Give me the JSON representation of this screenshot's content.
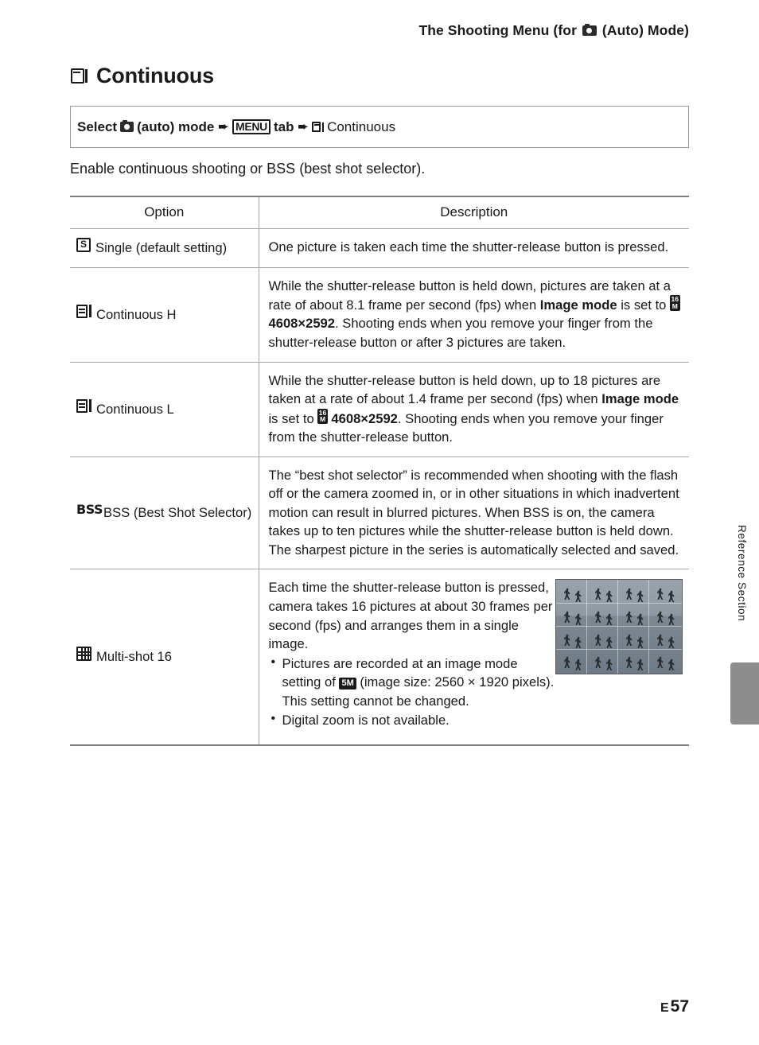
{
  "header": {
    "prefix": "The Shooting Menu (for ",
    "suffix": " (Auto) Mode)",
    "camera_icon": "camera-auto-icon"
  },
  "title": {
    "icon": "continuous-shooting-icon",
    "text": "Continuous"
  },
  "select_box": {
    "select_label": "Select",
    "auto_mode_label": "(auto) mode",
    "menu_tab_label": "MENU",
    "tab_word": "tab",
    "final_label": "Continuous",
    "arrow": "➨"
  },
  "intro": "Enable continuous shooting or BSS (best shot selector).",
  "table": {
    "headers": {
      "option": "Option",
      "description": "Description"
    },
    "rows": [
      {
        "icon": "single-shot-icon",
        "option": "Single (default setting)",
        "description": "One picture is taken each time the shutter-release button is pressed."
      },
      {
        "icon": "continuous-h-icon",
        "option": "Continuous H",
        "desc_parts": {
          "p1": "While the shutter-release button is held down, pictures are taken at a rate of about 8.1 frame per second (fps) when ",
          "bold1": "Image mode",
          "p2": " is set to ",
          "badge1_line1": "16",
          "badge1_line2": "M",
          "bold2": "4608×2592",
          "p3": ". Shooting ends when you remove your finger from the shutter-release button or after 3 pictures are taken."
        }
      },
      {
        "icon": "continuous-l-icon",
        "option": "Continuous L",
        "desc_parts": {
          "p1": "While the shutter-release button is held down, up to 18 pictures are taken at a rate of about 1.4 frame per second (fps) when ",
          "bold1": "Image mode",
          "p2": " is set to ",
          "badge1_line1": "16",
          "badge1_line2": "M",
          "bold2": "4608×2592",
          "p3": ". Shooting ends when you remove your finger from the shutter-release button."
        }
      },
      {
        "icon": "bss-icon",
        "icon_text": "BSS",
        "option": "BSS (Best Shot Selector)",
        "description": "The “best shot selector” is recommended when shooting with the flash off or the camera zoomed in, or in other situations in which inadvertent motion can result in blurred pictures. When BSS is on, the camera takes up to ten pictures while the shutter-release button is held down. The sharpest picture in the series is automatically selected and saved."
      },
      {
        "icon": "multi-shot-16-icon",
        "option": "Multi-shot 16",
        "desc_parts": {
          "p1": "Each time the shutter-release button is pressed, camera takes 16 pictures at about 30 frames per second (fps) and arranges them in a single image.",
          "bullet1_a": "Pictures are recorded at an image mode setting of ",
          "bullet1_badge": "5M",
          "bullet1_b": " (image size: 2560 × 1920 pixels). This setting cannot be changed.",
          "bullet2": "Digital zoom is not available."
        },
        "sample_image_alt": "multi-shot-16-sample-photo"
      }
    ]
  },
  "side_tab_text": "Reference Section",
  "footer": {
    "section": "E",
    "page": "57"
  }
}
